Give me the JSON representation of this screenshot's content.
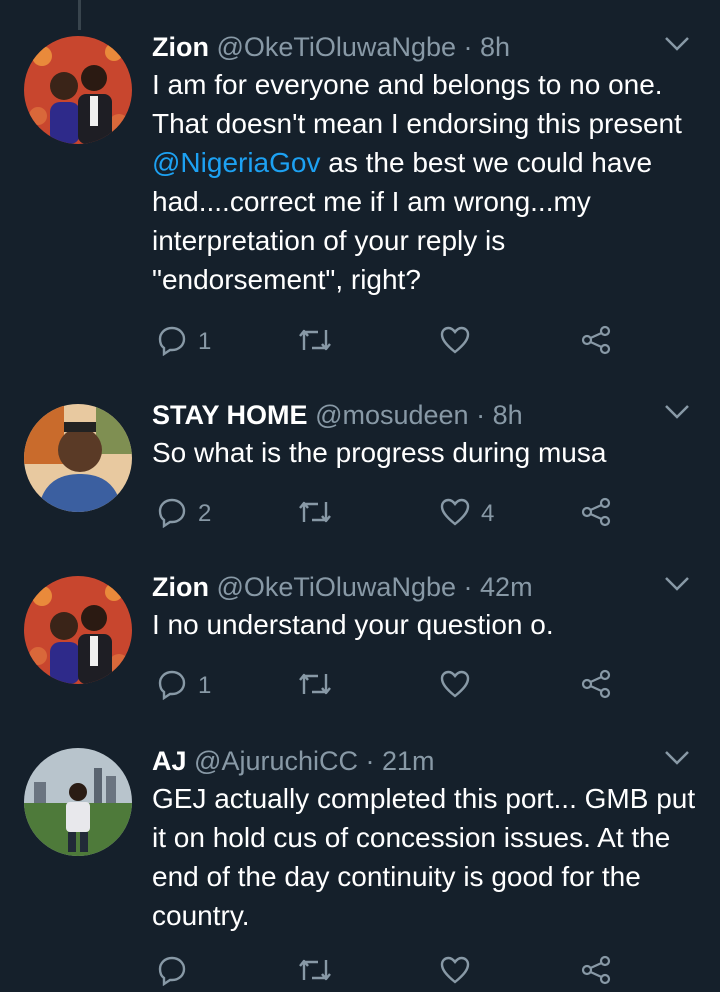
{
  "tweets": [
    {
      "name": "Zion",
      "handle": "@OkeTiOluwaNgbe",
      "separator": "·",
      "time": "8h",
      "text_before": "I am for everyone and belongs to no one. That doesn't mean I endorsing this present ",
      "mention": "@NigeriaGov",
      "text_after": " as the best we could have had....correct me if I am wrong...my interpretation of your reply is \"endorsement\", right?",
      "reply_count": "1",
      "retweet_count": "",
      "like_count": ""
    },
    {
      "name": "STAY HOME",
      "handle": "@mosudeen",
      "separator": "·",
      "time": "8h",
      "text": "So what is the progress during musa",
      "reply_count": "2",
      "retweet_count": "",
      "like_count": "4"
    },
    {
      "name": "Zion",
      "handle": "@OkeTiOluwaNgbe",
      "separator": "·",
      "time": "42m",
      "text": "I no understand your question o.",
      "reply_count": "1",
      "retweet_count": "",
      "like_count": ""
    },
    {
      "name": "AJ",
      "handle": "@AjuruchiCC",
      "separator": "·",
      "time": "21m",
      "text": "GEJ actually completed this port... GMB put it on hold cus of concession issues. At the end of the day continuity is good for the country.",
      "reply_count": "",
      "retweet_count": "",
      "like_count": ""
    }
  ],
  "colors": {
    "background": "#15202b",
    "primary_text": "#ffffff",
    "secondary_text": "#8899a6",
    "link": "#1da1f2"
  }
}
